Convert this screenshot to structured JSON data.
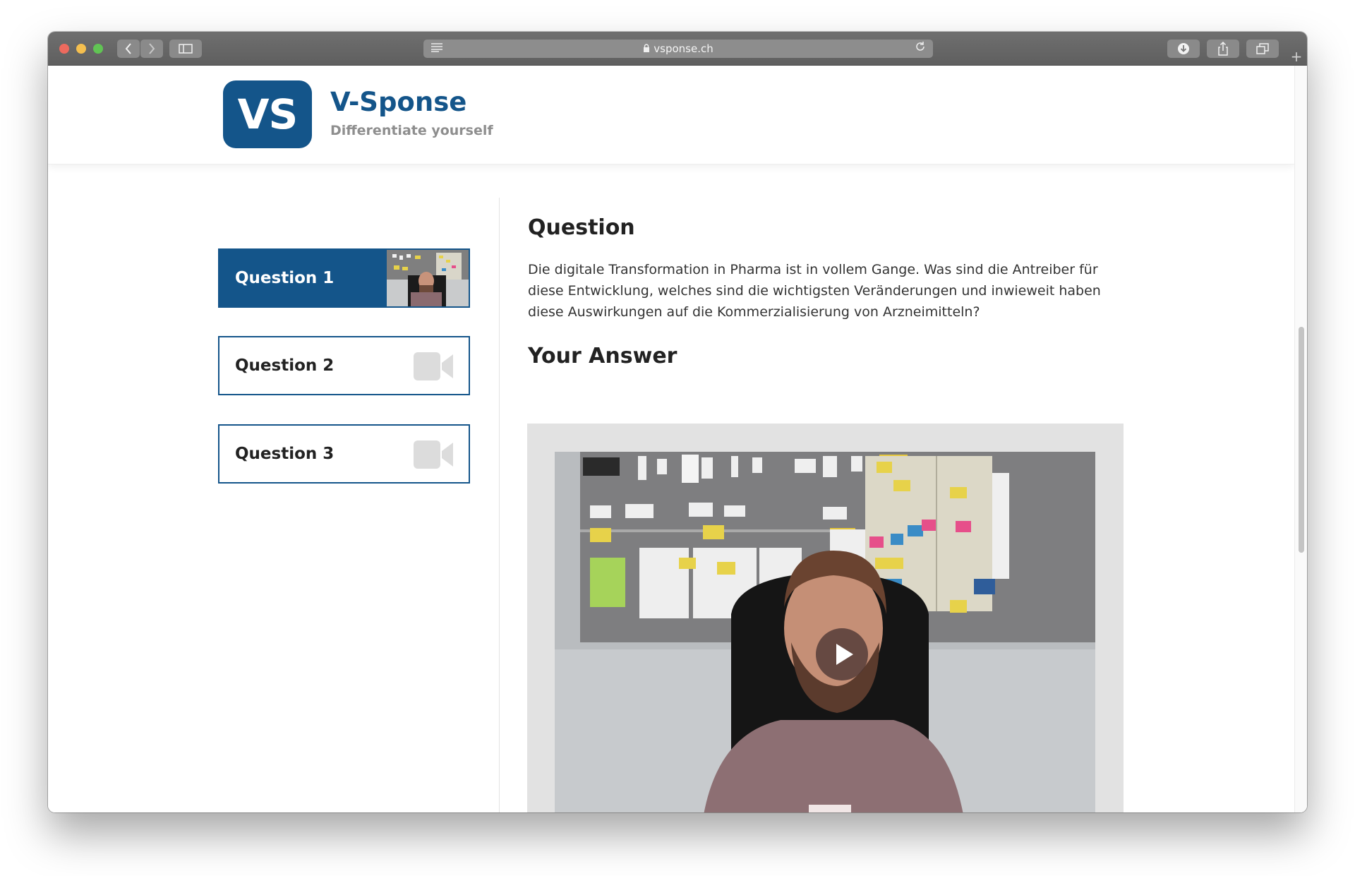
{
  "browser": {
    "url": "vsponse.ch",
    "icons": {
      "back": "chevron-left-icon",
      "forward": "chevron-right-icon",
      "sidebar": "sidebar-icon",
      "reader": "reader-icon",
      "lock": "lock-icon",
      "reload": "reload-icon",
      "download": "download-icon",
      "share": "share-icon",
      "tabs": "tabs-icon",
      "new_tab": "plus-icon"
    }
  },
  "header": {
    "logo_text": "VS",
    "brand_name": "V-Sponse",
    "tagline": "Differentiate yourself",
    "brand_color": "#14558a"
  },
  "questions": [
    {
      "label": "Question 1",
      "active": true,
      "icon": "video-thumbnail"
    },
    {
      "label": "Question 2",
      "active": false,
      "icon": "video-camera-icon"
    },
    {
      "label": "Question 3",
      "active": false,
      "icon": "video-camera-icon"
    }
  ],
  "main": {
    "question_heading": "Question",
    "question_text": "Die digitale Transformation in Pharma ist in vollem Gange. Was sind die Antreiber für diese Entwicklung, welches sind die wichtigsten Veränderungen und inwieweit haben diese Auswirkungen auf die Kommerzialisierung von Arzneimitteln?",
    "answer_heading": "Your Answer",
    "video": {
      "play_icon": "play-icon"
    }
  }
}
